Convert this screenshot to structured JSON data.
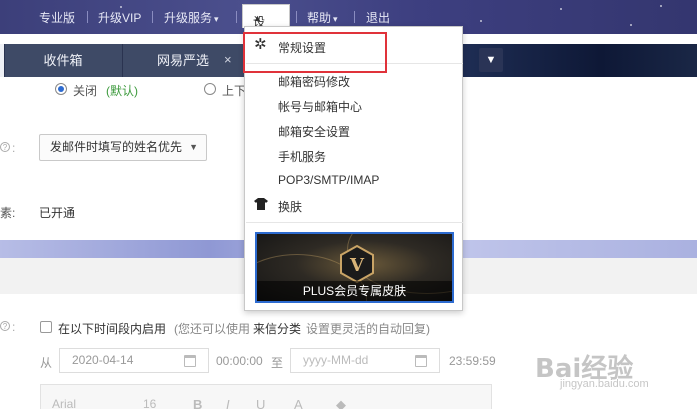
{
  "topnav": {
    "pro_edition": "专业版",
    "upgrade_vip": "升级VIP",
    "upgrade_service": "升级服务",
    "settings": "设置",
    "help": "帮助",
    "logout": "退出"
  },
  "tabs": [
    {
      "label": "收件箱"
    },
    {
      "label": "网易严选"
    }
  ],
  "content": {
    "radio_off_label": "关闭",
    "radio_off_default": "(默认)",
    "radio_other_label": "上下",
    "sender_name_select": "发邮件时填写的姓名优先",
    "status_label": "素:",
    "status_value": "已开通",
    "time_period_checkbox": "在以下时间段内启用",
    "time_period_hint_prefix": "(您还可以使用",
    "time_period_hint_link": "来信分类",
    "time_period_hint_suffix": "设置更灵活的自动回复)",
    "from_label": "从",
    "start_date": "2020-04-14",
    "start_time": "00:00:00",
    "to_label": "至",
    "end_date_placeholder": "yyyy-MM-dd",
    "end_time": "23:59:59",
    "font_name": "Arial",
    "font_size": "16",
    "bold": "B",
    "italic": "I",
    "underline": "U",
    "strike": "A"
  },
  "dropdown": {
    "items": [
      {
        "label": "常规设置"
      },
      {
        "label": "邮箱密码修改"
      },
      {
        "label": "帐号与邮箱中心"
      },
      {
        "label": "邮箱安全设置"
      },
      {
        "label": "手机服务"
      },
      {
        "label": "POP3/SMTP/IMAP"
      },
      {
        "label": "换肤"
      }
    ],
    "skin_badge": "V",
    "skin_caption": "PLUS会员专属皮肤"
  },
  "watermark": {
    "main": "Bai经验",
    "sub": "jingyan.baidu.com"
  },
  "colors": {
    "highlight": "#e0323a",
    "radio_selected": "#2d6bd0",
    "default_tag": "#3c9a3c"
  }
}
